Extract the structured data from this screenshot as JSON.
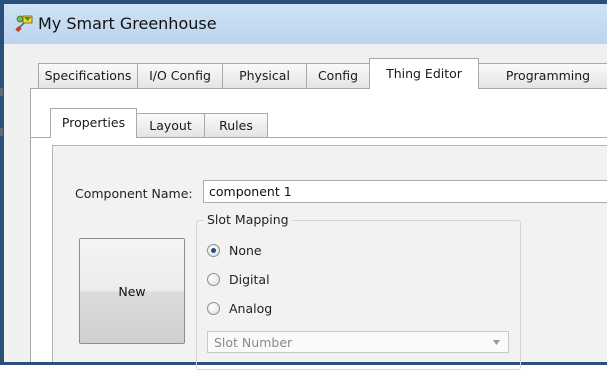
{
  "window": {
    "title": "My Smart Greenhouse",
    "icon": "greenhouse-app-icon"
  },
  "tabs": [
    {
      "label": "Specifications",
      "active": false
    },
    {
      "label": "I/O Config",
      "active": false
    },
    {
      "label": "Physical",
      "active": false
    },
    {
      "label": "Config",
      "active": false
    },
    {
      "label": "Thing Editor",
      "active": true
    },
    {
      "label": "Programming",
      "active": false
    }
  ],
  "thing_editor": {
    "tabs": [
      {
        "label": "Properties",
        "active": true
      },
      {
        "label": "Layout",
        "active": false
      },
      {
        "label": "Rules",
        "active": false
      }
    ],
    "component_name_label": "Component Name:",
    "component_name_value": "component 1",
    "new_button_label": "New",
    "slot_mapping": {
      "legend": "Slot Mapping",
      "options": [
        {
          "label": "None",
          "checked": true
        },
        {
          "label": "Digital",
          "checked": false
        },
        {
          "label": "Analog",
          "checked": false
        }
      ],
      "slot_number_placeholder": "Slot Number"
    }
  }
}
